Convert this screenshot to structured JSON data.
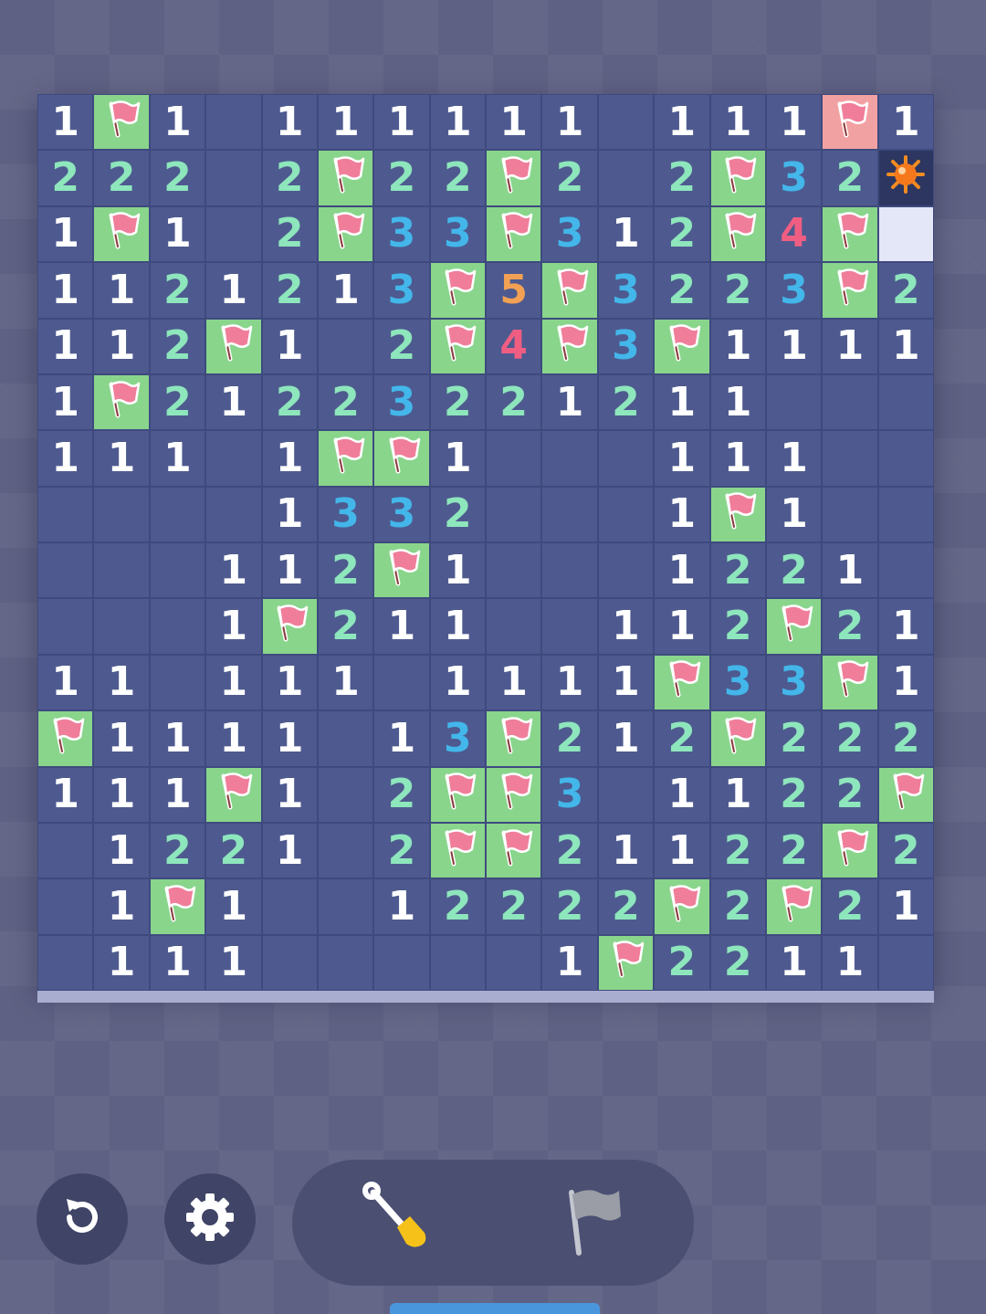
{
  "board": {
    "rows": 16,
    "cols": 16,
    "cell_legend": {
      "": "revealed empty",
      "1-5": "revealed number",
      "F": "correctly flagged",
      "W": "flag on wrong / highlighted cell",
      "M": "exploded mine",
      "U": "unrevealed cell"
    },
    "grid": [
      [
        "1",
        "F",
        "1",
        "",
        "1",
        "1",
        "1",
        "1",
        "1",
        "1",
        "",
        "1",
        "1",
        "1",
        "W",
        "1"
      ],
      [
        "2",
        "2",
        "2",
        "",
        "2",
        "F",
        "2",
        "2",
        "F",
        "2",
        "",
        "2",
        "F",
        "3",
        "2",
        "M"
      ],
      [
        "1",
        "F",
        "1",
        "",
        "2",
        "F",
        "3",
        "3",
        "F",
        "3",
        "1",
        "2",
        "F",
        "4",
        "F",
        "U"
      ],
      [
        "1",
        "1",
        "2",
        "1",
        "2",
        "1",
        "3",
        "F",
        "5",
        "F",
        "3",
        "2",
        "2",
        "3",
        "F",
        "2"
      ],
      [
        "1",
        "1",
        "2",
        "F",
        "1",
        "",
        "2",
        "F",
        "4",
        "F",
        "3",
        "F",
        "1",
        "1",
        "1",
        "1"
      ],
      [
        "1",
        "F",
        "2",
        "1",
        "2",
        "2",
        "3",
        "2",
        "2",
        "1",
        "2",
        "1",
        "1",
        "",
        "",
        ""
      ],
      [
        "1",
        "1",
        "1",
        "",
        "1",
        "F",
        "F",
        "1",
        "",
        "",
        "",
        "1",
        "1",
        "1",
        "",
        ""
      ],
      [
        "",
        "",
        "",
        "",
        "1",
        "3",
        "3",
        "2",
        "",
        "",
        "",
        "1",
        "F",
        "1",
        "",
        ""
      ],
      [
        "",
        "",
        "",
        "1",
        "1",
        "2",
        "F",
        "1",
        "",
        "",
        "",
        "1",
        "2",
        "2",
        "1",
        ""
      ],
      [
        "",
        "",
        "",
        "1",
        "F",
        "2",
        "1",
        "1",
        "",
        "",
        "1",
        "1",
        "2",
        "F",
        "2",
        "1"
      ],
      [
        "1",
        "1",
        "",
        "1",
        "1",
        "1",
        "",
        "1",
        "1",
        "1",
        "1",
        "F",
        "3",
        "3",
        "F",
        "1"
      ],
      [
        "F",
        "1",
        "1",
        "1",
        "1",
        "",
        "1",
        "3",
        "F",
        "2",
        "1",
        "2",
        "F",
        "2",
        "2",
        "2"
      ],
      [
        "1",
        "1",
        "1",
        "F",
        "1",
        "",
        "2",
        "F",
        "F",
        "3",
        "",
        "1",
        "1",
        "2",
        "2",
        "F"
      ],
      [
        "",
        "1",
        "2",
        "2",
        "1",
        "",
        "2",
        "F",
        "F",
        "2",
        "1",
        "1",
        "2",
        "2",
        "F",
        "2"
      ],
      [
        "",
        "1",
        "F",
        "1",
        "",
        "",
        "1",
        "2",
        "2",
        "2",
        "2",
        "F",
        "2",
        "F",
        "2",
        "1"
      ],
      [
        "",
        "1",
        "1",
        "1",
        "",
        "",
        "",
        "",
        "",
        "1",
        "F",
        "2",
        "2",
        "1",
        "1",
        ""
      ]
    ]
  },
  "colors": {
    "board_bg": "#4e5a8f",
    "flag_cell": "#89d58c",
    "wrong_flag_cell": "#f2a1a3",
    "number_1": "#ffffff",
    "number_2": "#8ee6bc",
    "number_3": "#43b6ea",
    "number_4": "#ef5e82",
    "number_5": "#f2a154"
  },
  "controls": {
    "restart_icon": "restart-icon",
    "settings_icon": "gear-icon",
    "dig_mode_icon": "shovel-icon",
    "flag_mode_icon": "flag-icon",
    "active_mode": "dig"
  }
}
